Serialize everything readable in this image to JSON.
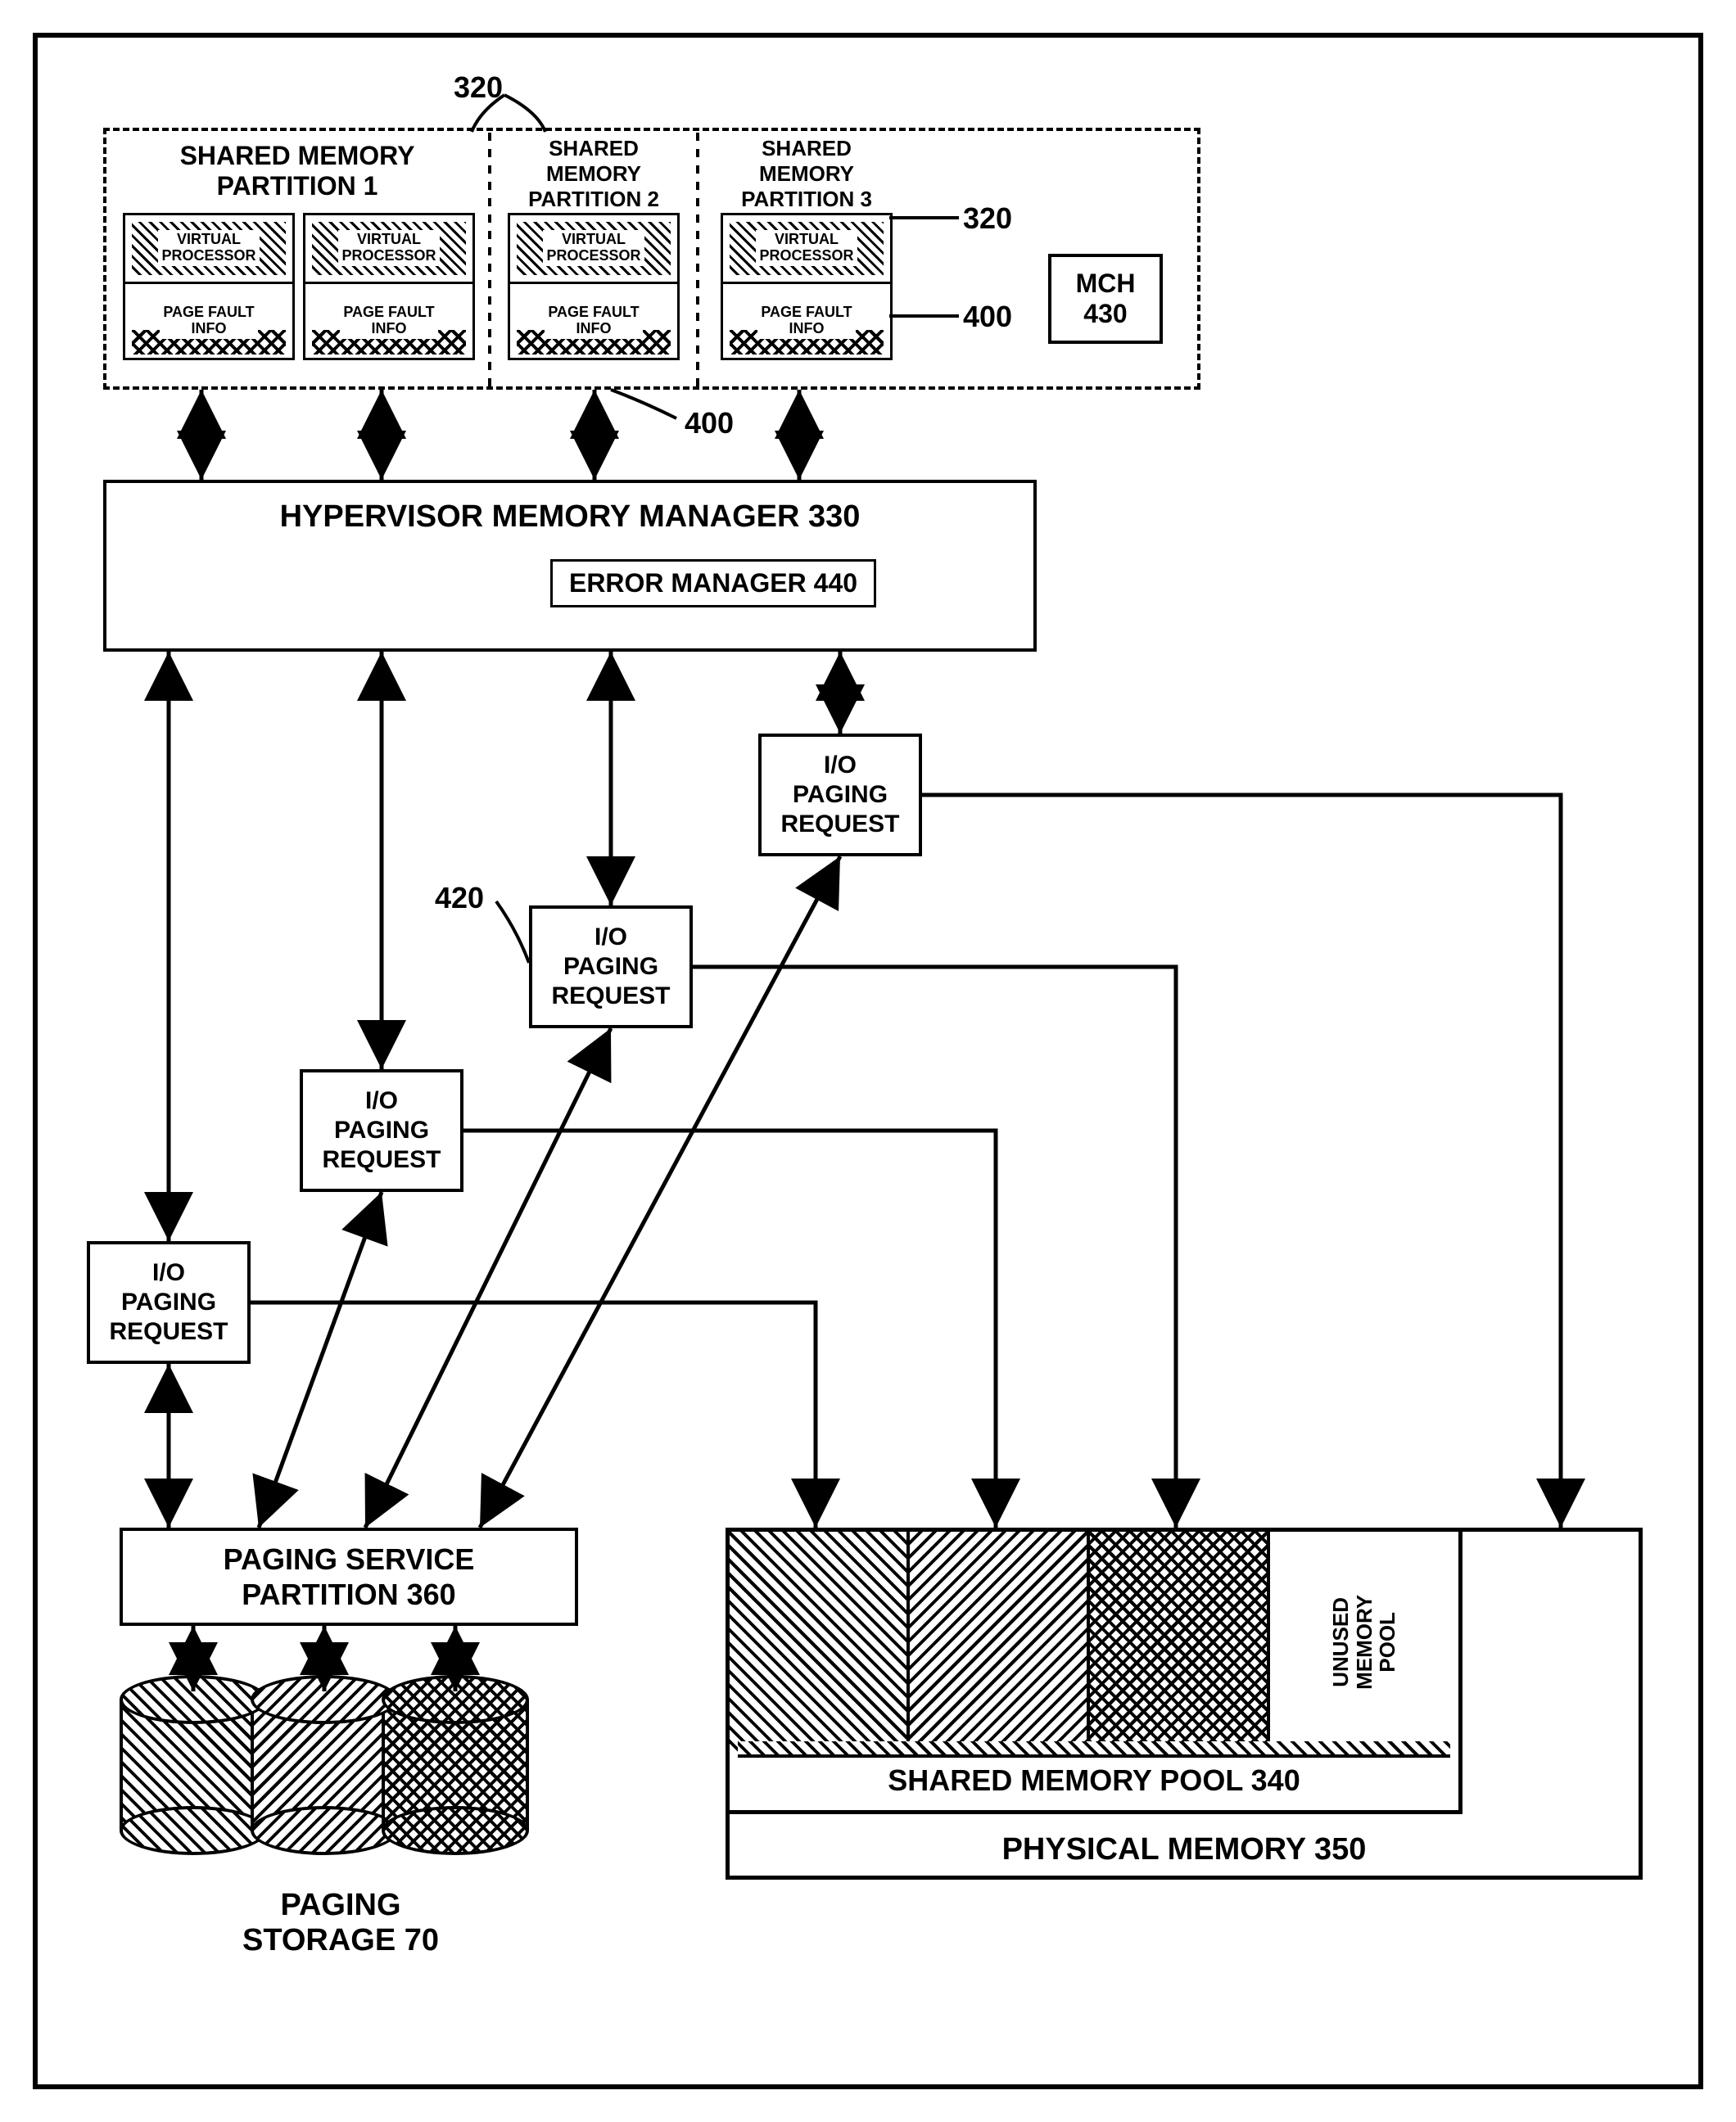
{
  "labels": {
    "ref_320_top": "320",
    "ref_320_right": "320",
    "ref_400_right": "400",
    "ref_400_bottom": "400",
    "ref_420": "420"
  },
  "partitions": {
    "p1": {
      "title_l1": "SHARED MEMORY",
      "title_l2": "PARTITION 1"
    },
    "p2": {
      "title_l1": "SHARED",
      "title_l2": "MEMORY",
      "title_l3": "PARTITION 2"
    },
    "p3": {
      "title_l1": "SHARED",
      "title_l2": "MEMORY",
      "title_l3": "PARTITION 3"
    }
  },
  "vp": {
    "top": "VIRTUAL\nPROCESSOR",
    "bottom": "PAGE FAULT\nINFO"
  },
  "mch": {
    "label_l1": "MCH",
    "label_l2": "430"
  },
  "hmm": {
    "title": "HYPERVISOR MEMORY MANAGER 330",
    "error_mgr": "ERROR MANAGER 440"
  },
  "io_request": {
    "l1": "I/O",
    "l2": "PAGING",
    "l3": "REQUEST"
  },
  "psp": {
    "l1": "PAGING SERVICE",
    "l2": "PARTITION 360"
  },
  "storage": {
    "l1": "PAGING",
    "l2": "STORAGE 70"
  },
  "memory": {
    "unused_l1": "UNUSED",
    "unused_l2": "MEMORY",
    "unused_l3": "POOL",
    "shared": "SHARED MEMORY POOL 340",
    "physical": "PHYSICAL MEMORY 350"
  },
  "chart_data": {
    "type": "diagram",
    "description": "System architecture diagram showing hypervisor memory management with shared memory partitions, paging service, and physical memory pool",
    "nodes": [
      {
        "id": "partition1",
        "label": "SHARED MEMORY PARTITION 1",
        "ref": 320,
        "children": [
          "VIRTUAL PROCESSOR",
          "VIRTUAL PROCESSOR"
        ],
        "sub": [
          "PAGE FAULT INFO",
          "PAGE FAULT INFO"
        ]
      },
      {
        "id": "partition2",
        "label": "SHARED MEMORY PARTITION 2",
        "ref": 320,
        "children": [
          "VIRTUAL PROCESSOR"
        ],
        "sub": [
          "PAGE FAULT INFO"
        ]
      },
      {
        "id": "partition3",
        "label": "SHARED MEMORY PARTITION 3",
        "ref": 320,
        "children": [
          "VIRTUAL PROCESSOR"
        ],
        "sub": [
          "PAGE FAULT INFO"
        ]
      },
      {
        "id": "mch",
        "label": "MCH",
        "ref": 430
      },
      {
        "id": "page_fault_info",
        "ref": 400
      },
      {
        "id": "hmm",
        "label": "HYPERVISOR MEMORY MANAGER",
        "ref": 330
      },
      {
        "id": "error_mgr",
        "label": "ERROR MANAGER",
        "ref": 440
      },
      {
        "id": "io_req",
        "label": "I/O PAGING REQUEST",
        "ref": 420,
        "count": 4
      },
      {
        "id": "psp",
        "label": "PAGING SERVICE PARTITION",
        "ref": 360
      },
      {
        "id": "paging_storage",
        "label": "PAGING STORAGE",
        "ref": 70,
        "count": 3
      },
      {
        "id": "shared_pool",
        "label": "SHARED MEMORY POOL",
        "ref": 340
      },
      {
        "id": "unused_pool",
        "label": "UNUSED MEMORY POOL"
      },
      {
        "id": "physical_memory",
        "label": "PHYSICAL MEMORY",
        "ref": 350
      }
    ],
    "edges": [
      {
        "from": "partition1",
        "to": "hmm",
        "type": "bidirectional"
      },
      {
        "from": "partition2",
        "to": "hmm",
        "type": "bidirectional"
      },
      {
        "from": "partition3",
        "to": "hmm",
        "type": "bidirectional"
      },
      {
        "from": "hmm",
        "to": "io_req",
        "type": "bidirectional",
        "count": 4
      },
      {
        "from": "io_req",
        "to": "psp",
        "type": "bidirectional"
      },
      {
        "from": "io_req",
        "to": "shared_pool",
        "type": "directed"
      },
      {
        "from": "psp",
        "to": "paging_storage",
        "type": "bidirectional"
      }
    ]
  }
}
